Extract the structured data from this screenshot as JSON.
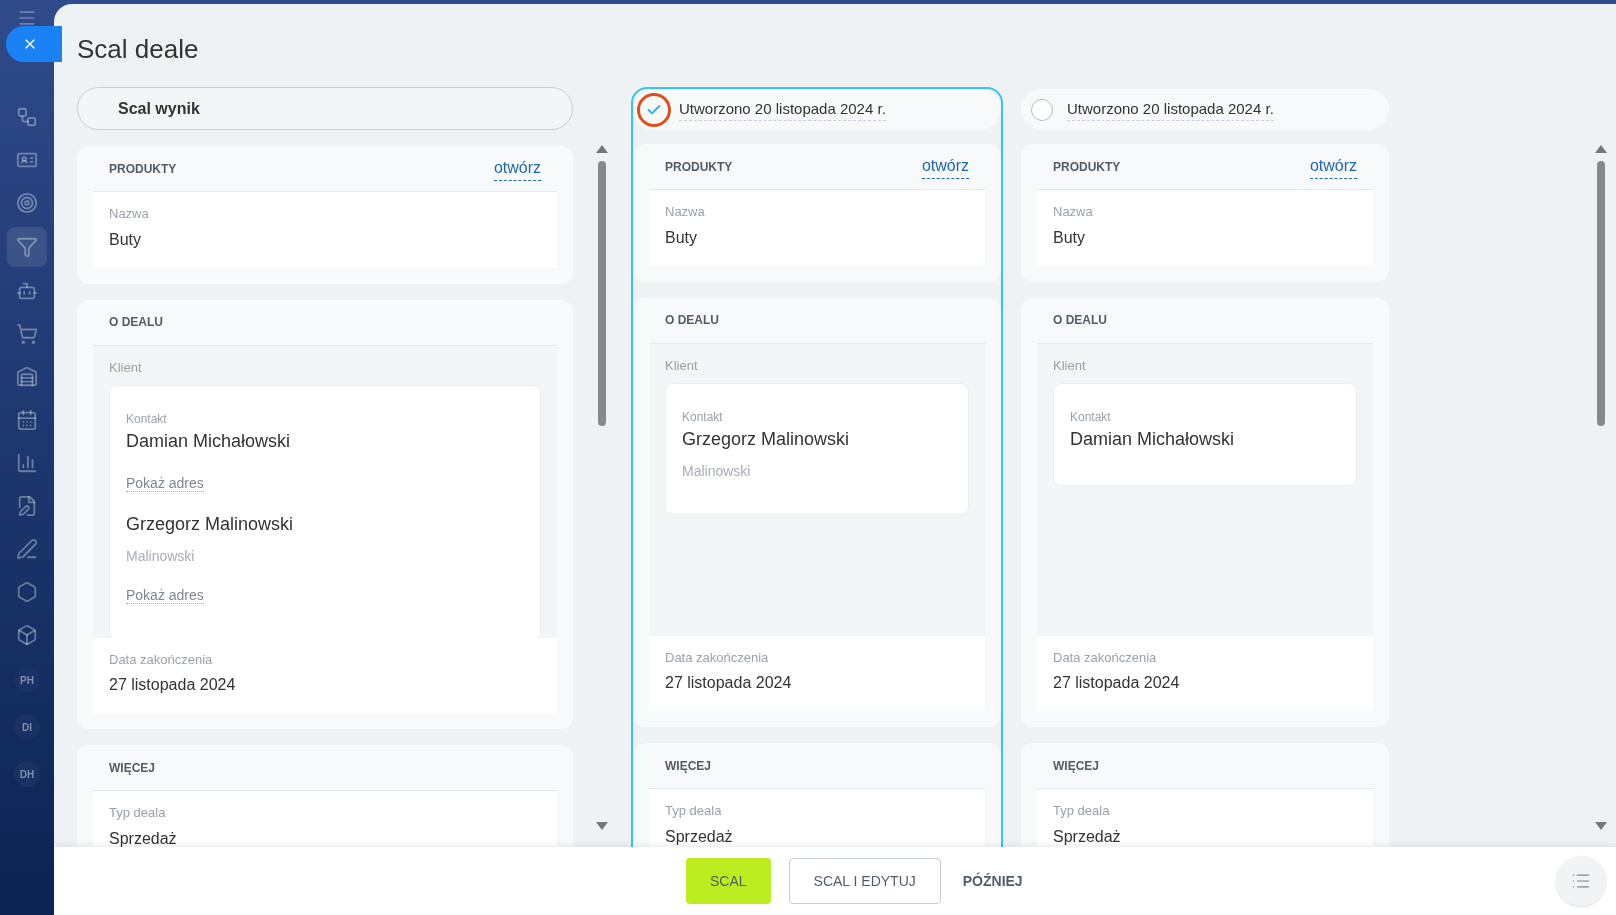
{
  "title": "Scal deale",
  "sidebar": {
    "avatars": [
      "PH",
      "DI",
      "DH"
    ]
  },
  "result": {
    "label": "Scal wynik",
    "sections": [
      {
        "title": "PRODUKTY",
        "link": "otwórz",
        "items": [
          {
            "kind": "field",
            "label": "Nazwa",
            "value": "Buty"
          }
        ]
      },
      {
        "title": "O DEALU",
        "items": [
          {
            "kind": "client",
            "label": "Klient",
            "contacts": [
              {
                "role": "Kontakt",
                "name": "Damian Michałowski",
                "link": "Pokaż adres"
              },
              {
                "name": "Grzegorz Malinowski",
                "subtitle": "Malinowski",
                "link": "Pokaż adres"
              }
            ]
          },
          {
            "kind": "field",
            "label": "Data zakończenia",
            "value": "27 listopada 2024"
          }
        ]
      },
      {
        "title": "WIĘCEJ",
        "items": [
          {
            "kind": "field",
            "label": "Typ deala",
            "value": "Sprzedaż"
          }
        ]
      }
    ]
  },
  "candidates": [
    {
      "label": "Utworzono 20 listopada 2024 r.",
      "selected": true,
      "sections": [
        {
          "title": "PRODUKTY",
          "link": "otwórz",
          "items": [
            {
              "kind": "field",
              "label": "Nazwa",
              "value": "Buty"
            }
          ]
        },
        {
          "title": "O DEALU",
          "items": [
            {
              "kind": "client",
              "label": "Klient",
              "contacts": [
                {
                  "role": "Kontakt",
                  "name": "Grzegorz Malinowski",
                  "subtitle": "Malinowski"
                }
              ]
            },
            {
              "kind": "field",
              "label": "Data zakończenia",
              "value": "27 listopada 2024"
            }
          ]
        },
        {
          "title": "WIĘCEJ",
          "items": [
            {
              "kind": "field",
              "label": "Typ deala",
              "value": "Sprzedaż"
            }
          ]
        }
      ]
    },
    {
      "label": "Utworzono 20 listopada 2024 r.",
      "selected": false,
      "sections": [
        {
          "title": "PRODUKTY",
          "link": "otwórz",
          "items": [
            {
              "kind": "field",
              "label": "Nazwa",
              "value": "Buty"
            }
          ]
        },
        {
          "title": "O DEALU",
          "items": [
            {
              "kind": "client",
              "label": "Klient",
              "contacts": [
                {
                  "role": "Kontakt",
                  "name": "Damian Michałowski"
                }
              ]
            },
            {
              "kind": "field",
              "label": "Data zakończenia",
              "value": "27 listopada 2024"
            }
          ]
        },
        {
          "title": "WIĘCEJ",
          "items": [
            {
              "kind": "field",
              "label": "Typ deala",
              "value": "Sprzedaż"
            }
          ]
        }
      ]
    }
  ],
  "buttons": {
    "merge": "SCAL",
    "merge_edit": "SCAL I EDYTUJ",
    "later": "PÓŹNIEJ"
  }
}
